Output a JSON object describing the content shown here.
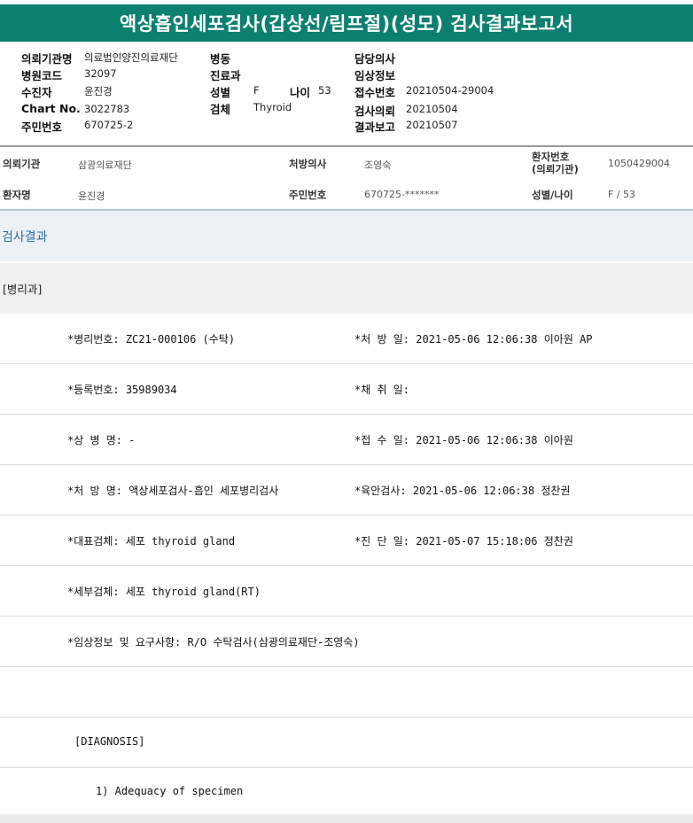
{
  "report": {
    "title": "액상흡인세포검사(갑상선/림프절)(성모) 검사결과보고서"
  },
  "header": {
    "col1": [
      {
        "label": "의뢰기관명",
        "value": "의료법인양진의료재단"
      },
      {
        "label": "병원코드",
        "value": "32097"
      },
      {
        "label": "수진자",
        "value": "윤진경"
      },
      {
        "label": "Chart No.",
        "value": "3022783"
      },
      {
        "label": "주민번호",
        "value": "670725-2"
      }
    ],
    "col2": {
      "ward_label": "병동",
      "dept_label": "진료과",
      "sex_label": "성별",
      "sex_value": "F",
      "age_label": "나이",
      "age_value": "53",
      "specimen_label": "검체",
      "specimen_value": "Thyroid"
    },
    "col3": [
      {
        "label": "담당의사",
        "value": ""
      },
      {
        "label": "임상정보",
        "value": ""
      },
      {
        "label": "접수번호",
        "value": "20210504-29004"
      },
      {
        "label": "검사의뢰",
        "value": "20210504"
      },
      {
        "label": "결과보고",
        "value": "20210507"
      }
    ]
  },
  "patient_info": {
    "inst_label": "의뢰기관",
    "inst_value": "삼광의료재단",
    "doctor_label": "처방의사",
    "doctor_value": "조영숙",
    "patno_label_line1": "환자번호",
    "patno_label_line2": "(의뢰기관)",
    "patno_value": "1050429004",
    "name_label": "환자명",
    "name_value": "윤진경",
    "rrn_label": "주민번호",
    "rrn_value": "670725-*******",
    "sexage_label": "성별/나이",
    "sexage_value": "F / 53"
  },
  "results": {
    "section_title": "검사결과",
    "department": "[병리과]",
    "rows": [
      {
        "left": "*병리번호: ZC21-000106 (수탁)",
        "right": "*처 방 일: 2021-05-06 12:06:38  이아원 AP"
      },
      {
        "left": "*등록번호: 35989034",
        "right": "*채 취 일:"
      },
      {
        "left": "*상 병 명: -",
        "right": "*접 수 일: 2021-05-06 12:06:38  이아원"
      },
      {
        "left": "*처 방 명: 액상세포검사-흡인 세포병리검사",
        "right": "*육안검사: 2021-05-06 12:06:38  정찬권"
      },
      {
        "left": "*대표검체: 세포 thyroid gland",
        "right": "*진 단 일: 2021-05-07 15:18:06  정찬권"
      },
      {
        "left": "*세부검체: 세포 thyroid gland(RT)",
        "right": ""
      },
      {
        "left": "*임상정보 및 요구사항: R/O 수탁검사(삼광의료재단-조영숙)",
        "right": ""
      },
      {
        "left": "",
        "right": ""
      },
      {
        "left": "[DIAGNOSIS]",
        "right": ""
      },
      {
        "left": "1) Adequacy of specimen",
        "right": ""
      }
    ]
  }
}
